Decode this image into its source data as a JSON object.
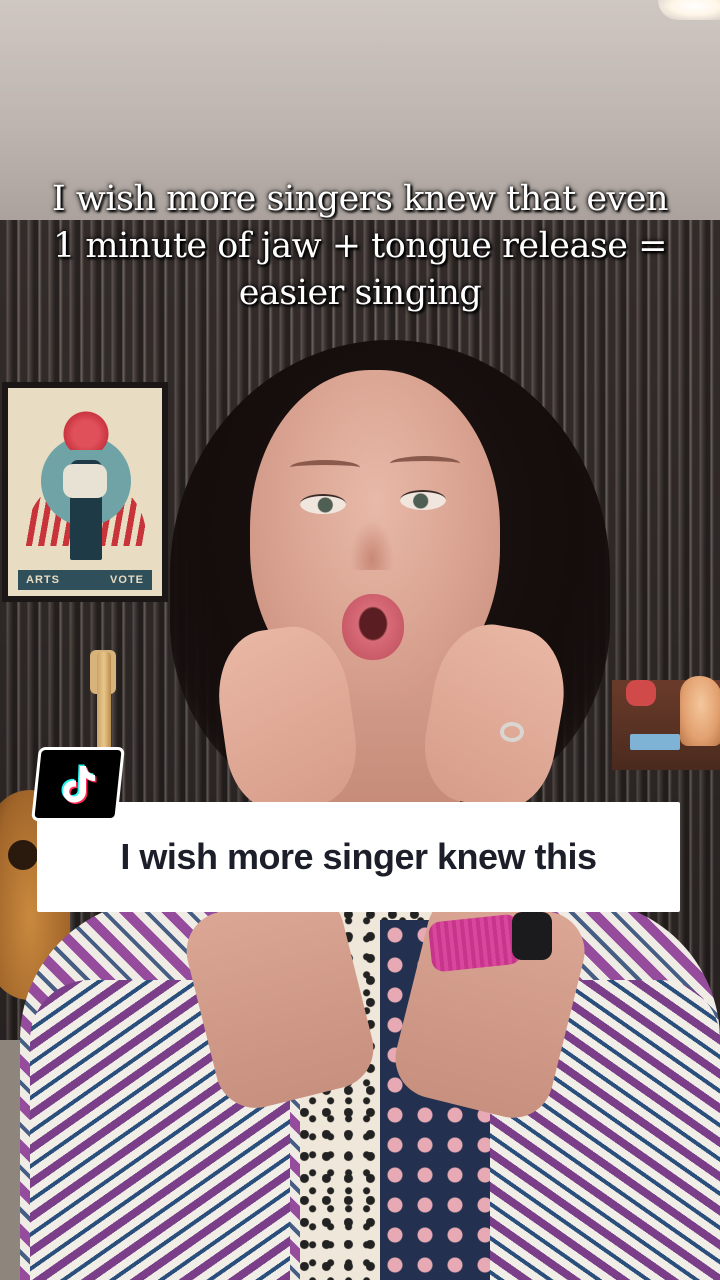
{
  "caption": {
    "text": "I wish more singers knew that even\n1 minute of jaw + tongue release =\neasier singing"
  },
  "banner": {
    "text": "I wish more singer knew this"
  },
  "logo": {
    "icon": "tiktok-logo-icon"
  },
  "poster": {
    "left_word": "ARTS",
    "right_word": "VOTE"
  },
  "colors": {
    "caption_text": "#ffffff",
    "banner_bg": "#ffffff",
    "banner_text": "#1c1f2a",
    "badge_bg": "#000000"
  }
}
